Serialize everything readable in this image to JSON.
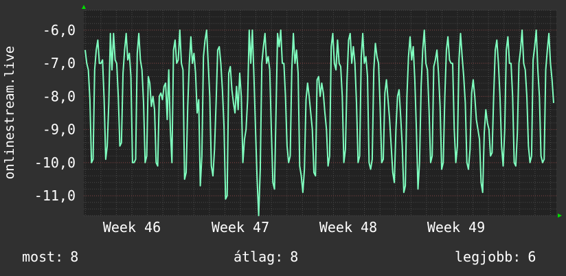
{
  "chart_data": {
    "type": "line",
    "ylabel": "onlinestream.live",
    "y_ticks": [
      "-6,0",
      "-7,0",
      "-8,0",
      "-9,0",
      "-10,0",
      "-11,0"
    ],
    "y_tick_values": [
      -6,
      -7,
      -8,
      -9,
      -10,
      -11
    ],
    "ylim": [
      -11.6,
      -5.4
    ],
    "x_ticks": [
      "Week 46",
      "Week 47",
      "Week 48",
      "Week 49"
    ],
    "grid": true,
    "series": [
      {
        "color": "#7fffbf",
        "values": [
          -6.6,
          -7.0,
          -7.2,
          -8.1,
          -10.0,
          -9.9,
          -7.2,
          -6.6,
          -6.3,
          -7.0,
          -7.0,
          -6.9,
          -8.1,
          -9.9,
          -9.5,
          -8.2,
          -6.1,
          -7.2,
          -6.1,
          -6.9,
          -7.0,
          -8.0,
          -9.5,
          -9.4,
          -7.3,
          -6.6,
          -6.1,
          -6.9,
          -6.7,
          -7.4,
          -10.0,
          -10.0,
          -9.9,
          -6.7,
          -6.1,
          -6.9,
          -7.2,
          -8.2,
          -10.0,
          -9.8,
          -7.4,
          -7.6,
          -8.3,
          -8.0,
          -8.4,
          -10.0,
          -10.1,
          -8.0,
          -7.9,
          -8.1,
          -7.7,
          -7.6,
          -8.7,
          -7.2,
          -9.0,
          -10.0,
          -6.6,
          -6.3,
          -7.0,
          -6.9,
          -6.0,
          -7.0,
          -7.2,
          -10.5,
          -10.3,
          -8.3,
          -7.0,
          -6.2,
          -7.0,
          -6.7,
          -7.3,
          -8.5,
          -8.1,
          -10.7,
          -9.8,
          -6.8,
          -6.3,
          -6.0,
          -7.0,
          -8.0,
          -10.1,
          -10.4,
          -9.6,
          -8.2,
          -6.6,
          -6.5,
          -7.0,
          -7.8,
          -8.9,
          -11.1,
          -11.0,
          -7.3,
          -7.1,
          -7.8,
          -8.2,
          -8.5,
          -7.7,
          -8.4,
          -7.3,
          -8.0,
          -10.0,
          -9.3,
          -9.0,
          -8.1,
          -6.0,
          -7.0,
          -6.0,
          -7.4,
          -9.0,
          -10.5,
          -11.6,
          -10.2,
          -7.0,
          -6.5,
          -6.1,
          -7.0,
          -6.8,
          -7.2,
          -9.0,
          -10.6,
          -10.8,
          -8.4,
          -6.1,
          -6.5,
          -6.0,
          -7.0,
          -7.0,
          -8.0,
          -9.5,
          -10.0,
          -9.8,
          -7.2,
          -6.1,
          -7.0,
          -6.6,
          -7.3,
          -10.1,
          -10.4,
          -10.9,
          -10.2,
          -8.1,
          -7.6,
          -8.0,
          -8.5,
          -9.0,
          -10.3,
          -10.4,
          -7.5,
          -7.4,
          -8.0,
          -7.6,
          -7.9,
          -8.5,
          -9.0,
          -10.1,
          -9.8,
          -6.5,
          -6.1,
          -7.0,
          -7.2,
          -6.3,
          -7.0,
          -7.1,
          -8.0,
          -10.0,
          -9.6,
          -7.5,
          -6.3,
          -6.1,
          -7.0,
          -6.5,
          -7.0,
          -8.2,
          -10.0,
          -9.8,
          -6.8,
          -6.1,
          -7.0,
          -6.8,
          -7.4,
          -10.0,
          -10.2,
          -9.9,
          -7.2,
          -6.4,
          -6.8,
          -7.0,
          -8.3,
          -10.0,
          -9.9,
          -7.9,
          -7.5,
          -8.1,
          -8.7,
          -9.5,
          -10.3,
          -10.6,
          -9.0,
          -8.0,
          -7.8,
          -8.6,
          -9.5,
          -10.9,
          -10.7,
          -8.0,
          -6.8,
          -6.2,
          -6.9,
          -6.5,
          -7.5,
          -9.0,
          -10.8,
          -10.0,
          -7.7,
          -6.6,
          -6.0,
          -7.0,
          -7.2,
          -8.4,
          -10.0,
          -9.8,
          -7.1,
          -6.9,
          -6.6,
          -7.3,
          -8.3,
          -10.2,
          -10.0,
          -8.0,
          -6.6,
          -6.2,
          -6.9,
          -7.0,
          -7.0,
          -9.0,
          -10.0,
          -9.5,
          -6.9,
          -6.1,
          -6.8,
          -7.4,
          -8.2,
          -10.0,
          -10.2,
          -9.6,
          -7.9,
          -7.5,
          -8.0,
          -8.7,
          -9.0,
          -9.3,
          -10.6,
          -10.9,
          -9.1,
          -8.4,
          -8.8,
          -9.0,
          -9.8,
          -9.7,
          -8.0,
          -6.6,
          -6.3,
          -7.0,
          -8.0,
          -9.5,
          -10.1,
          -9.0,
          -6.6,
          -6.2,
          -7.0,
          -7.0,
          -8.0,
          -10.0,
          -10.1,
          -9.1,
          -7.0,
          -6.6,
          -6.0,
          -7.0,
          -7.2,
          -8.0,
          -9.5,
          -10.0,
          -9.8,
          -6.9,
          -6.5,
          -6.0,
          -7.2,
          -8.0,
          -9.8,
          -10.0,
          -9.9,
          -7.2,
          -6.6,
          -6.1,
          -7.0,
          -7.5,
          -8.2
        ]
      }
    ]
  },
  "stats": {
    "current_label": "most:",
    "current_value": "8",
    "average_label": "átlag:",
    "average_value": "8",
    "best_label": "legjobb:",
    "best_value": "6"
  },
  "colors": {
    "background": "#303030",
    "plot_background": "#222222",
    "line": "#7fffbf",
    "grid_major": "#8a4a4a",
    "grid_minor": "#4a4a4a",
    "axis_arrow": "#00dd00",
    "text": "#ffffff"
  }
}
